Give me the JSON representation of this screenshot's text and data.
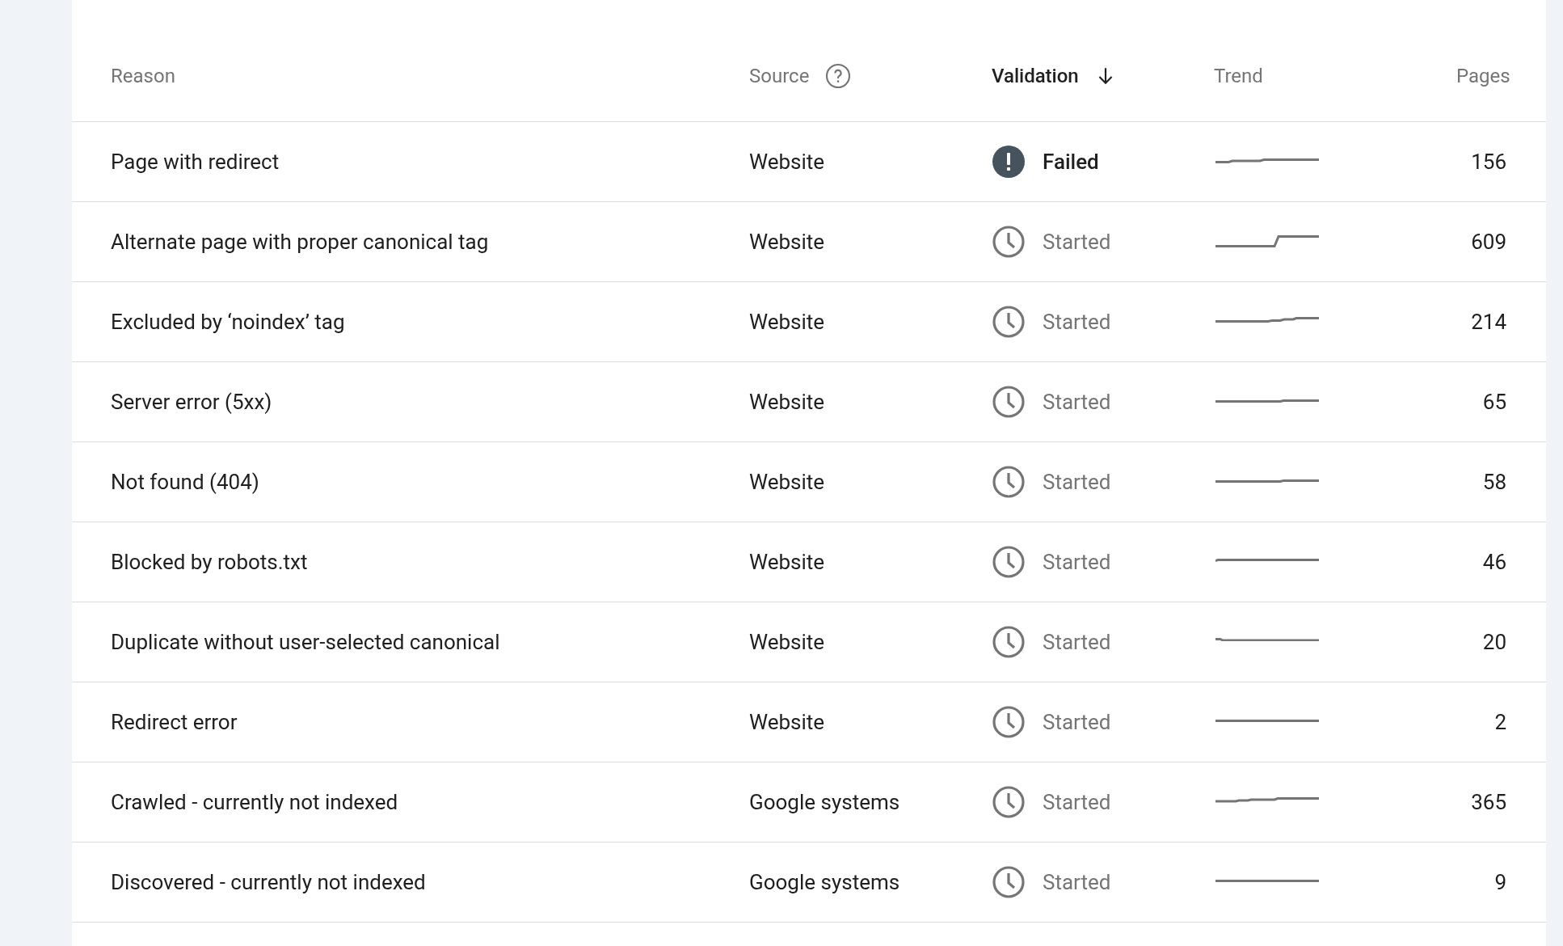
{
  "table": {
    "columns": [
      {
        "label": "Reason",
        "help": false,
        "sorted": false
      },
      {
        "label": "Source",
        "help": true,
        "sorted": false
      },
      {
        "label": "Validation",
        "help": false,
        "sorted": true
      },
      {
        "label": "Trend",
        "help": false,
        "sorted": false
      },
      {
        "label": "Pages",
        "help": false,
        "sorted": false
      }
    ],
    "rows": [
      {
        "reason": "Page with redirect",
        "source": "Website",
        "validation": {
          "kind": "failed",
          "label": "Failed"
        },
        "pages": "156"
      },
      {
        "reason": "Alternate page with proper canonical tag",
        "source": "Website",
        "validation": {
          "kind": "started",
          "label": "Started"
        },
        "pages": "609"
      },
      {
        "reason": "Excluded by ‘noindex’ tag",
        "source": "Website",
        "validation": {
          "kind": "started",
          "label": "Started"
        },
        "pages": "214"
      },
      {
        "reason": "Server error (5xx)",
        "source": "Website",
        "validation": {
          "kind": "started",
          "label": "Started"
        },
        "pages": "65"
      },
      {
        "reason": "Not found (404)",
        "source": "Website",
        "validation": {
          "kind": "started",
          "label": "Started"
        },
        "pages": "58"
      },
      {
        "reason": "Blocked by robots.txt",
        "source": "Website",
        "validation": {
          "kind": "started",
          "label": "Started"
        },
        "pages": "46"
      },
      {
        "reason": "Duplicate without user-selected canonical",
        "source": "Website",
        "validation": {
          "kind": "started",
          "label": "Started"
        },
        "pages": "20"
      },
      {
        "reason": "Redirect error",
        "source": "Website",
        "validation": {
          "kind": "started",
          "label": "Started"
        },
        "pages": "2"
      },
      {
        "reason": "Crawled - currently not indexed",
        "source": "Google systems",
        "validation": {
          "kind": "started",
          "label": "Started"
        },
        "pages": "365"
      },
      {
        "reason": "Discovered - currently not indexed",
        "source": "Google systems",
        "validation": {
          "kind": "started",
          "label": "Started"
        },
        "pages": "9"
      }
    ]
  }
}
